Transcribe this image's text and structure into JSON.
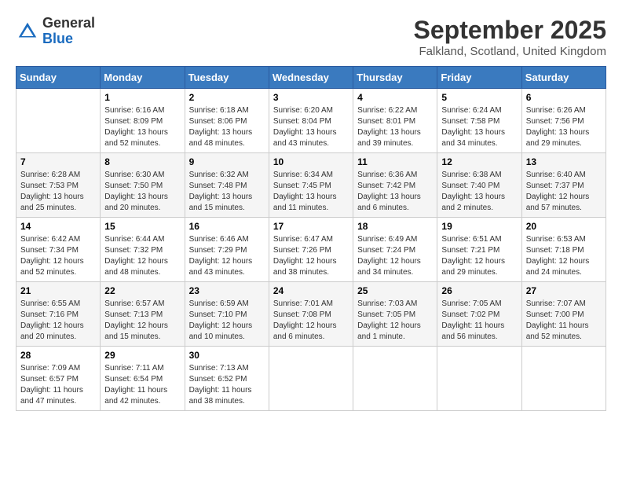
{
  "header": {
    "logo_line1": "General",
    "logo_line2": "Blue",
    "month_title": "September 2025",
    "location": "Falkland, Scotland, United Kingdom"
  },
  "calendar": {
    "days_of_week": [
      "Sunday",
      "Monday",
      "Tuesday",
      "Wednesday",
      "Thursday",
      "Friday",
      "Saturday"
    ],
    "weeks": [
      [
        {
          "num": "",
          "info": ""
        },
        {
          "num": "1",
          "info": "Sunrise: 6:16 AM\nSunset: 8:09 PM\nDaylight: 13 hours\nand 52 minutes."
        },
        {
          "num": "2",
          "info": "Sunrise: 6:18 AM\nSunset: 8:06 PM\nDaylight: 13 hours\nand 48 minutes."
        },
        {
          "num": "3",
          "info": "Sunrise: 6:20 AM\nSunset: 8:04 PM\nDaylight: 13 hours\nand 43 minutes."
        },
        {
          "num": "4",
          "info": "Sunrise: 6:22 AM\nSunset: 8:01 PM\nDaylight: 13 hours\nand 39 minutes."
        },
        {
          "num": "5",
          "info": "Sunrise: 6:24 AM\nSunset: 7:58 PM\nDaylight: 13 hours\nand 34 minutes."
        },
        {
          "num": "6",
          "info": "Sunrise: 6:26 AM\nSunset: 7:56 PM\nDaylight: 13 hours\nand 29 minutes."
        }
      ],
      [
        {
          "num": "7",
          "info": "Sunrise: 6:28 AM\nSunset: 7:53 PM\nDaylight: 13 hours\nand 25 minutes."
        },
        {
          "num": "8",
          "info": "Sunrise: 6:30 AM\nSunset: 7:50 PM\nDaylight: 13 hours\nand 20 minutes."
        },
        {
          "num": "9",
          "info": "Sunrise: 6:32 AM\nSunset: 7:48 PM\nDaylight: 13 hours\nand 15 minutes."
        },
        {
          "num": "10",
          "info": "Sunrise: 6:34 AM\nSunset: 7:45 PM\nDaylight: 13 hours\nand 11 minutes."
        },
        {
          "num": "11",
          "info": "Sunrise: 6:36 AM\nSunset: 7:42 PM\nDaylight: 13 hours\nand 6 minutes."
        },
        {
          "num": "12",
          "info": "Sunrise: 6:38 AM\nSunset: 7:40 PM\nDaylight: 13 hours\nand 2 minutes."
        },
        {
          "num": "13",
          "info": "Sunrise: 6:40 AM\nSunset: 7:37 PM\nDaylight: 12 hours\nand 57 minutes."
        }
      ],
      [
        {
          "num": "14",
          "info": "Sunrise: 6:42 AM\nSunset: 7:34 PM\nDaylight: 12 hours\nand 52 minutes."
        },
        {
          "num": "15",
          "info": "Sunrise: 6:44 AM\nSunset: 7:32 PM\nDaylight: 12 hours\nand 48 minutes."
        },
        {
          "num": "16",
          "info": "Sunrise: 6:46 AM\nSunset: 7:29 PM\nDaylight: 12 hours\nand 43 minutes."
        },
        {
          "num": "17",
          "info": "Sunrise: 6:47 AM\nSunset: 7:26 PM\nDaylight: 12 hours\nand 38 minutes."
        },
        {
          "num": "18",
          "info": "Sunrise: 6:49 AM\nSunset: 7:24 PM\nDaylight: 12 hours\nand 34 minutes."
        },
        {
          "num": "19",
          "info": "Sunrise: 6:51 AM\nSunset: 7:21 PM\nDaylight: 12 hours\nand 29 minutes."
        },
        {
          "num": "20",
          "info": "Sunrise: 6:53 AM\nSunset: 7:18 PM\nDaylight: 12 hours\nand 24 minutes."
        }
      ],
      [
        {
          "num": "21",
          "info": "Sunrise: 6:55 AM\nSunset: 7:16 PM\nDaylight: 12 hours\nand 20 minutes."
        },
        {
          "num": "22",
          "info": "Sunrise: 6:57 AM\nSunset: 7:13 PM\nDaylight: 12 hours\nand 15 minutes."
        },
        {
          "num": "23",
          "info": "Sunrise: 6:59 AM\nSunset: 7:10 PM\nDaylight: 12 hours\nand 10 minutes."
        },
        {
          "num": "24",
          "info": "Sunrise: 7:01 AM\nSunset: 7:08 PM\nDaylight: 12 hours\nand 6 minutes."
        },
        {
          "num": "25",
          "info": "Sunrise: 7:03 AM\nSunset: 7:05 PM\nDaylight: 12 hours\nand 1 minute."
        },
        {
          "num": "26",
          "info": "Sunrise: 7:05 AM\nSunset: 7:02 PM\nDaylight: 11 hours\nand 56 minutes."
        },
        {
          "num": "27",
          "info": "Sunrise: 7:07 AM\nSunset: 7:00 PM\nDaylight: 11 hours\nand 52 minutes."
        }
      ],
      [
        {
          "num": "28",
          "info": "Sunrise: 7:09 AM\nSunset: 6:57 PM\nDaylight: 11 hours\nand 47 minutes."
        },
        {
          "num": "29",
          "info": "Sunrise: 7:11 AM\nSunset: 6:54 PM\nDaylight: 11 hours\nand 42 minutes."
        },
        {
          "num": "30",
          "info": "Sunrise: 7:13 AM\nSunset: 6:52 PM\nDaylight: 11 hours\nand 38 minutes."
        },
        {
          "num": "",
          "info": ""
        },
        {
          "num": "",
          "info": ""
        },
        {
          "num": "",
          "info": ""
        },
        {
          "num": "",
          "info": ""
        }
      ]
    ]
  }
}
